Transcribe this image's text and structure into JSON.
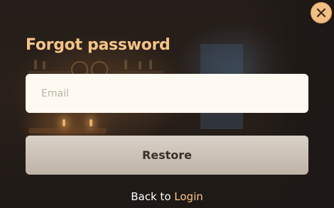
{
  "dialog": {
    "title": "Forgot password",
    "close_icon": "close-icon"
  },
  "form": {
    "email_value": "",
    "email_placeholder": "Email",
    "submit_label": "Restore"
  },
  "footer": {
    "prefix": "Back to",
    "link_label": "Login"
  },
  "colors": {
    "accent": "#f4c487",
    "input_bg": "#fffaf1",
    "button_bg": "#cfc5ba"
  }
}
